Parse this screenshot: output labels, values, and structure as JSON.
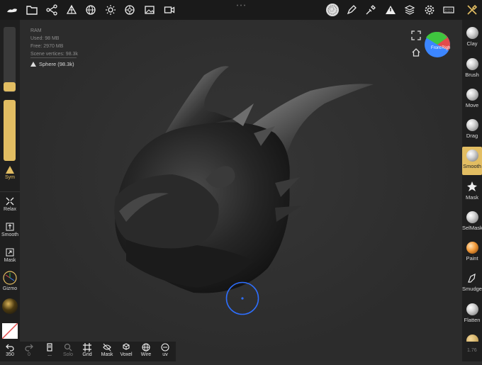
{
  "topbar": {
    "icons": [
      "nomad-logo-icon",
      "folder-icon",
      "scene-graph-icon",
      "primitives-icon",
      "grid-sphere-icon",
      "sun-icon",
      "material-ball-icon",
      "image-icon",
      "video-icon",
      "texture-sphere-icon",
      "pen-icon",
      "picker-icon",
      "warning-triangle-icon",
      "layers-icon",
      "gear-icon",
      "keyboard-icon",
      "tools-icon"
    ]
  },
  "scene_info": {
    "ram": "RAM",
    "used": "Used: 98 MB",
    "free": "Free: 2970 MB",
    "vertices": "Scene vertices: 98.3k",
    "mesh_name": "Sphere (98.3k)"
  },
  "left_panel": {
    "sym_label": "Sym",
    "relax_label": "Relax",
    "smooth_label": "Smooth",
    "mask_label": "Mask",
    "gizmo_label": "Gizmo"
  },
  "right_tools": [
    {
      "label": "Clay",
      "active": false
    },
    {
      "label": "Brush",
      "active": false
    },
    {
      "label": "Move",
      "active": false
    },
    {
      "label": "Drag",
      "active": false
    },
    {
      "label": "Smooth",
      "active": true
    },
    {
      "label": "Mask",
      "active": false
    },
    {
      "label": "SelMask",
      "active": false
    },
    {
      "label": "Paint",
      "active": false
    },
    {
      "label": "Smudge",
      "active": false
    },
    {
      "label": "Flatten",
      "active": false
    }
  ],
  "bottom_bar": {
    "undo_count": "350",
    "redo_count": "0",
    "dots": "...",
    "solo_label": "Solo",
    "grid_label": "Grid",
    "mask_label": "Mask",
    "voxel_label": "Voxel",
    "wire_label": "Wire",
    "uv_label": "uv"
  },
  "gizmo": {
    "front_label": "Front",
    "right_label": "Righ",
    "top_label": "Top"
  },
  "version": "1.76",
  "colors": {
    "accent": "#e2bd62",
    "brush_cursor": "#2e6fff"
  }
}
